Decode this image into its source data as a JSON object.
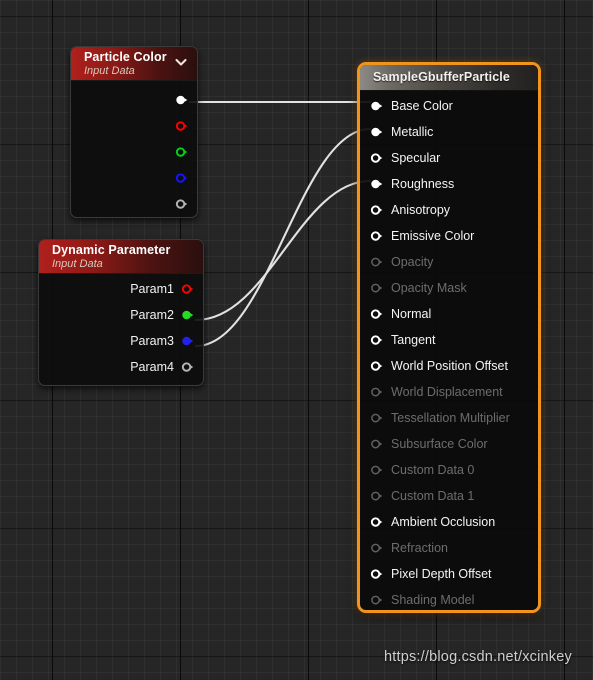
{
  "graph": {
    "background_color": "#262626",
    "grid_minor_color": "#2e2e2e",
    "grid_major_color": "#111111",
    "wire_color": "#e2e2e2"
  },
  "watermark": {
    "text": "https://blog.csdn.net/xcinkey"
  },
  "nodes": {
    "particle_color": {
      "title": "Particle Color",
      "subtitle": "Input Data",
      "header_color": "#b0201c",
      "collapse_icon": "chevron-down-icon",
      "outputs": [
        {
          "label": "",
          "color": "#ffffff",
          "connected": true,
          "name": "rgba"
        },
        {
          "label": "",
          "color": "#ff0000",
          "connected": false,
          "name": "r"
        },
        {
          "label": "",
          "color": "#00d21e",
          "connected": false,
          "name": "g"
        },
        {
          "label": "",
          "color": "#1414ff",
          "connected": false,
          "name": "b"
        },
        {
          "label": "",
          "color": "#b4b4b4",
          "connected": false,
          "name": "a"
        }
      ]
    },
    "dynamic_parameter": {
      "title": "Dynamic Parameter",
      "subtitle": "Input Data",
      "header_color": "#b0201c",
      "outputs": [
        {
          "label": "Param1",
          "color": "#ff0000",
          "connected": false
        },
        {
          "label": "Param2",
          "color": "#22dd22",
          "connected": true
        },
        {
          "label": "Param3",
          "color": "#2222ee",
          "connected": true
        },
        {
          "label": "Param4",
          "color": "#b4b4b4",
          "connected": false
        }
      ]
    },
    "sample_gbuffer_particle": {
      "title": "SampleGbufferParticle",
      "selected": true,
      "selection_color": "#f0941e",
      "inputs": [
        {
          "label": "Base Color",
          "enabled": true,
          "connected": true
        },
        {
          "label": "Metallic",
          "enabled": true,
          "connected": true
        },
        {
          "label": "Specular",
          "enabled": true,
          "connected": false
        },
        {
          "label": "Roughness",
          "enabled": true,
          "connected": true
        },
        {
          "label": "Anisotropy",
          "enabled": true,
          "connected": false
        },
        {
          "label": "Emissive Color",
          "enabled": true,
          "connected": false
        },
        {
          "label": "Opacity",
          "enabled": false,
          "connected": false
        },
        {
          "label": "Opacity Mask",
          "enabled": false,
          "connected": false
        },
        {
          "label": "Normal",
          "enabled": true,
          "connected": false
        },
        {
          "label": "Tangent",
          "enabled": true,
          "connected": false
        },
        {
          "label": "World Position Offset",
          "enabled": true,
          "connected": false
        },
        {
          "label": "World Displacement",
          "enabled": false,
          "connected": false
        },
        {
          "label": "Tessellation Multiplier",
          "enabled": false,
          "connected": false
        },
        {
          "label": "Subsurface Color",
          "enabled": false,
          "connected": false
        },
        {
          "label": "Custom Data 0",
          "enabled": false,
          "connected": false
        },
        {
          "label": "Custom Data 1",
          "enabled": false,
          "connected": false
        },
        {
          "label": "Ambient Occlusion",
          "enabled": true,
          "connected": false
        },
        {
          "label": "Refraction",
          "enabled": false,
          "connected": false
        },
        {
          "label": "Pixel Depth Offset",
          "enabled": true,
          "connected": false
        },
        {
          "label": "Shading Model",
          "enabled": false,
          "connected": false
        }
      ]
    }
  },
  "connections": [
    {
      "from": "particle_color.rgba",
      "to": "sample_gbuffer_particle.Base Color"
    },
    {
      "from": "dynamic_parameter.Param3",
      "to": "sample_gbuffer_particle.Metallic"
    },
    {
      "from": "dynamic_parameter.Param2",
      "to": "sample_gbuffer_particle.Roughness"
    }
  ]
}
